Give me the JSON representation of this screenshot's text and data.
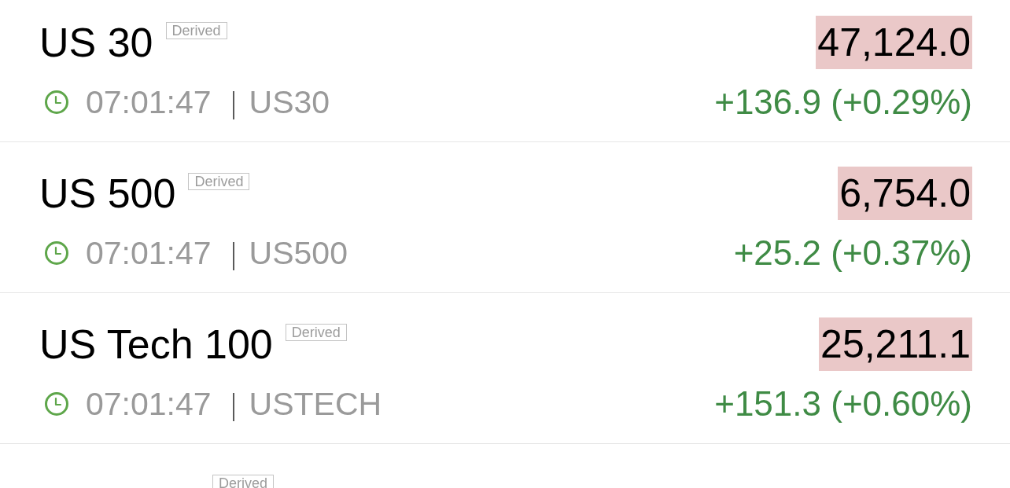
{
  "quotes": [
    {
      "name": "US 30",
      "badge": "Derived",
      "price": "47,124.0",
      "price_highlighted": true,
      "time": "07:01:47",
      "symbol": "US30",
      "change": "+136.9 (+0.29%)"
    },
    {
      "name": "US 500",
      "badge": "Derived",
      "price": "6,754.0",
      "price_highlighted": true,
      "time": "07:01:47",
      "symbol": "US500",
      "change": "+25.2 (+0.37%)"
    },
    {
      "name": "US Tech 100",
      "badge": "Derived",
      "price": "25,211.1",
      "price_highlighted": true,
      "time": "07:01:47",
      "symbol": "USTECH",
      "change": "+151.3 (+0.60%)"
    },
    {
      "badge": "Derived"
    }
  ]
}
